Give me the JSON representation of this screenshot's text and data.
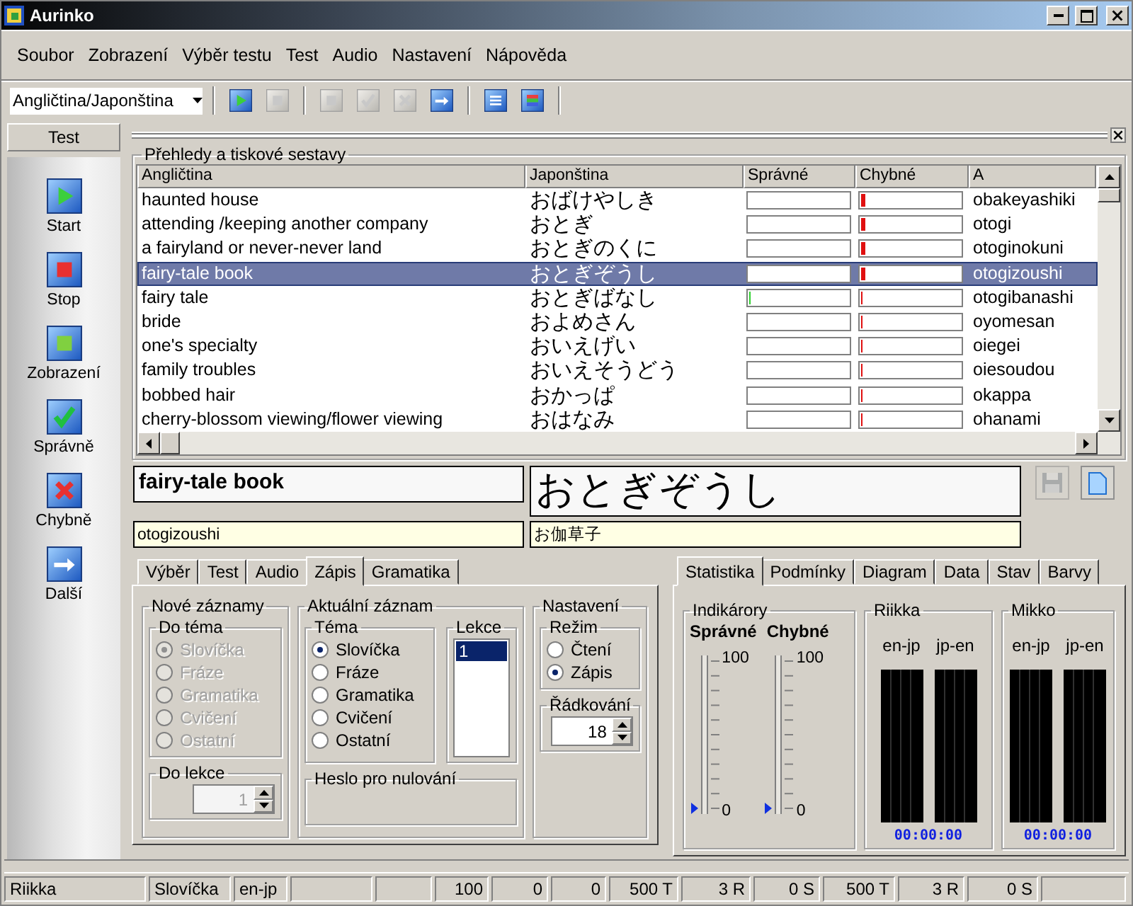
{
  "window": {
    "title": "Aurinko"
  },
  "menu": [
    "Soubor",
    "Zobrazení",
    "Výběr testu",
    "Test",
    "Audio",
    "Nastavení",
    "Nápověda"
  ],
  "toolbar": {
    "language": "Angličtina/Japonština",
    "groups": [
      [
        {
          "kind": "play",
          "disabled": false
        },
        {
          "kind": "stop",
          "disabled": true
        }
      ],
      [
        {
          "kind": "square",
          "disabled": true
        },
        {
          "kind": "check",
          "disabled": true
        },
        {
          "kind": "cross",
          "disabled": true
        },
        {
          "kind": "arrow",
          "disabled": false
        }
      ],
      [
        {
          "kind": "list",
          "disabled": false
        },
        {
          "kind": "stripes",
          "disabled": false
        }
      ]
    ]
  },
  "sidebar": {
    "header": "Test",
    "items": [
      {
        "label": "Start",
        "kind": "play"
      },
      {
        "label": "Stop",
        "kind": "stop"
      },
      {
        "label": "Zobrazení",
        "kind": "square"
      },
      {
        "label": "Správně",
        "kind": "check"
      },
      {
        "label": "Chybně",
        "kind": "cross"
      },
      {
        "label": "Další",
        "kind": "arrow"
      }
    ]
  },
  "report": {
    "title": "Přehledy a tiskové sestavy",
    "columns": [
      "Angličtina",
      "Japonština",
      "Správné",
      "Chybné",
      "A"
    ],
    "rows": [
      {
        "english": "haunted house",
        "japanese": "おばけやしき",
        "correct": {
          "level": 0
        },
        "wrong": {
          "level": 0.04
        },
        "romaji": "obakeyashiki",
        "selected": false
      },
      {
        "english": "attending /keeping another company",
        "japanese": "おとぎ",
        "correct": {
          "level": 0
        },
        "wrong": {
          "level": 0.04
        },
        "romaji": "otogi",
        "selected": false
      },
      {
        "english": "a fairyland or never-never land",
        "japanese": "おとぎのくに",
        "correct": {
          "level": 0
        },
        "wrong": {
          "level": 0.04
        },
        "romaji": "otoginokuni",
        "selected": false
      },
      {
        "english": "fairy-tale book",
        "japanese": "おとぎぞうし",
        "correct": {
          "level": 0
        },
        "wrong": {
          "level": 0.04
        },
        "romaji": "otogizoushi",
        "selected": true
      },
      {
        "english": "fairy tale",
        "japanese": "おとぎばなし",
        "correct": {
          "level": 0.02
        },
        "wrong": {
          "level": 0.02
        },
        "romaji": "otogibanashi",
        "selected": false
      },
      {
        "english": "bride",
        "japanese": "およめさん",
        "correct": {
          "level": 0
        },
        "wrong": {
          "level": 0.02
        },
        "romaji": "oyomesan",
        "selected": false
      },
      {
        "english": "one's specialty",
        "japanese": "おいえげい",
        "correct": {
          "level": 0
        },
        "wrong": {
          "level": 0.02
        },
        "romaji": "oiegei",
        "selected": false
      },
      {
        "english": "family troubles",
        "japanese": "おいえそうどう",
        "correct": {
          "level": 0
        },
        "wrong": {
          "level": 0.02
        },
        "romaji": "oiesoudou",
        "selected": false
      },
      {
        "english": "bobbed hair",
        "japanese": "おかっぱ",
        "correct": {
          "level": 0
        },
        "wrong": {
          "level": 0.02
        },
        "romaji": "okappa",
        "selected": false
      },
      {
        "english": "cherry-blossom viewing/flower viewing",
        "japanese": "おはなみ",
        "correct": {
          "level": 0
        },
        "wrong": {
          "level": 0.02
        },
        "romaji": "ohanami",
        "selected": false
      }
    ]
  },
  "detail": {
    "english": "fairy-tale book",
    "japanese": "おとぎぞうし",
    "romaji": "otogizoushi",
    "kanji": "お伽草子",
    "save_disabled": true
  },
  "left_tabs": [
    {
      "label": "Výběr",
      "selected": false
    },
    {
      "label": "Test",
      "selected": false
    },
    {
      "label": "Audio",
      "selected": false
    },
    {
      "label": "Zápis",
      "selected": true
    },
    {
      "label": "Gramatika",
      "selected": false
    }
  ],
  "zapis": {
    "new_records": {
      "title": "Nové záznamy",
      "topic_title": "Do téma",
      "options": [
        {
          "label": "Slovíčka",
          "selected": true
        },
        {
          "label": "Fráze",
          "selected": false
        },
        {
          "label": "Gramatika",
          "selected": false
        },
        {
          "label": "Cvičení",
          "selected": false
        },
        {
          "label": "Ostatní",
          "selected": false
        }
      ],
      "disabled": true,
      "lesson_title": "Do lekce",
      "lesson_value": "1"
    },
    "current": {
      "title": "Aktuální záznam",
      "topic_title": "Téma",
      "options": [
        {
          "label": "Slovíčka",
          "selected": true
        },
        {
          "label": "Fráze",
          "selected": false
        },
        {
          "label": "Gramatika",
          "selected": false
        },
        {
          "label": "Cvičení",
          "selected": false
        },
        {
          "label": "Ostatní",
          "selected": false
        }
      ],
      "lesson_title": "Lekce",
      "lessons": [
        {
          "label": "1",
          "selected": true
        }
      ],
      "password_title": "Heslo pro nulování"
    },
    "settings": {
      "title": "Nastavení",
      "mode_title": "Režim",
      "modes": [
        {
          "label": "Čtení",
          "selected": false
        },
        {
          "label": "Zápis",
          "selected": true
        }
      ],
      "spacing_title": "Řádkování",
      "spacing_value": "18"
    }
  },
  "right_tabs": [
    {
      "label": "Statistika",
      "selected": true
    },
    {
      "label": "Podmínky",
      "selected": false
    },
    {
      "label": "Diagram",
      "selected": false
    },
    {
      "label": "Data",
      "selected": false
    },
    {
      "label": "Stav",
      "selected": false
    },
    {
      "label": "Barvy",
      "selected": false
    }
  ],
  "statistics": {
    "indicators_title": "Indikárory",
    "indicators": [
      {
        "label": "Správné",
        "level": 0,
        "max": "100",
        "min": "0"
      },
      {
        "label": "Chybné",
        "level": 0,
        "max": "100",
        "min": "0"
      }
    ],
    "users": [
      {
        "name": "Riikka",
        "channels": [
          "en-jp",
          "jp-en"
        ],
        "time": "00:00:00"
      },
      {
        "name": "Mikko",
        "channels": [
          "en-jp",
          "jp-en"
        ],
        "time": "00:00:00"
      }
    ]
  },
  "status_bar": [
    "Riikka",
    "Slovíčka",
    "en-jp",
    "100",
    "0",
    "0",
    "500 T",
    "3 R",
    "0 S",
    "500 T",
    "3 R",
    "0 S"
  ]
}
